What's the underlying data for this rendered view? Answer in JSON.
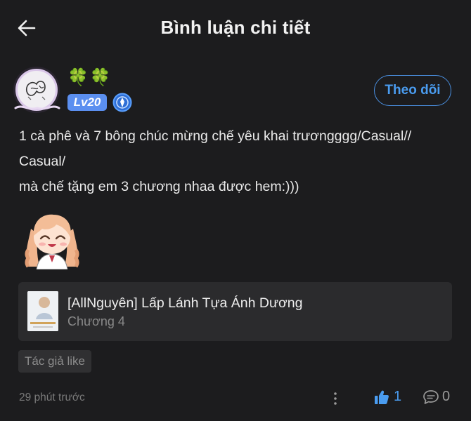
{
  "header": {
    "title": "Bình luận chi tiết",
    "back_icon": "arrow-left-icon"
  },
  "user": {
    "avatar_icon": "avatar-image",
    "clovers": [
      "🍀",
      "🍀"
    ],
    "level": "Lv20",
    "rank_icon": "rank-badge-icon",
    "follow_label": "Theo dõi"
  },
  "comment": {
    "lines": [
      "1 cà phê và 7 bông chúc mừng chế yêu khai trươngggg/Casual//",
      "Casual/",
      "mà chế tặng em 3 chương nhaa được hem:)))"
    ],
    "sticker_icon": "anime-girl-sticker"
  },
  "chapter_card": {
    "title": "[AllNguyên] Lấp Lánh Tựa Ánh Dương",
    "subtitle": "Chương 4"
  },
  "author_like_tag": "Tác giả like",
  "footer": {
    "time": "29 phút trước",
    "like_count": "1",
    "comment_count": "0"
  },
  "colors": {
    "background": "#1c1c1e",
    "accent": "#4a9cf0",
    "card": "#2b2b2d",
    "level_badge": "#5b8ff0"
  }
}
